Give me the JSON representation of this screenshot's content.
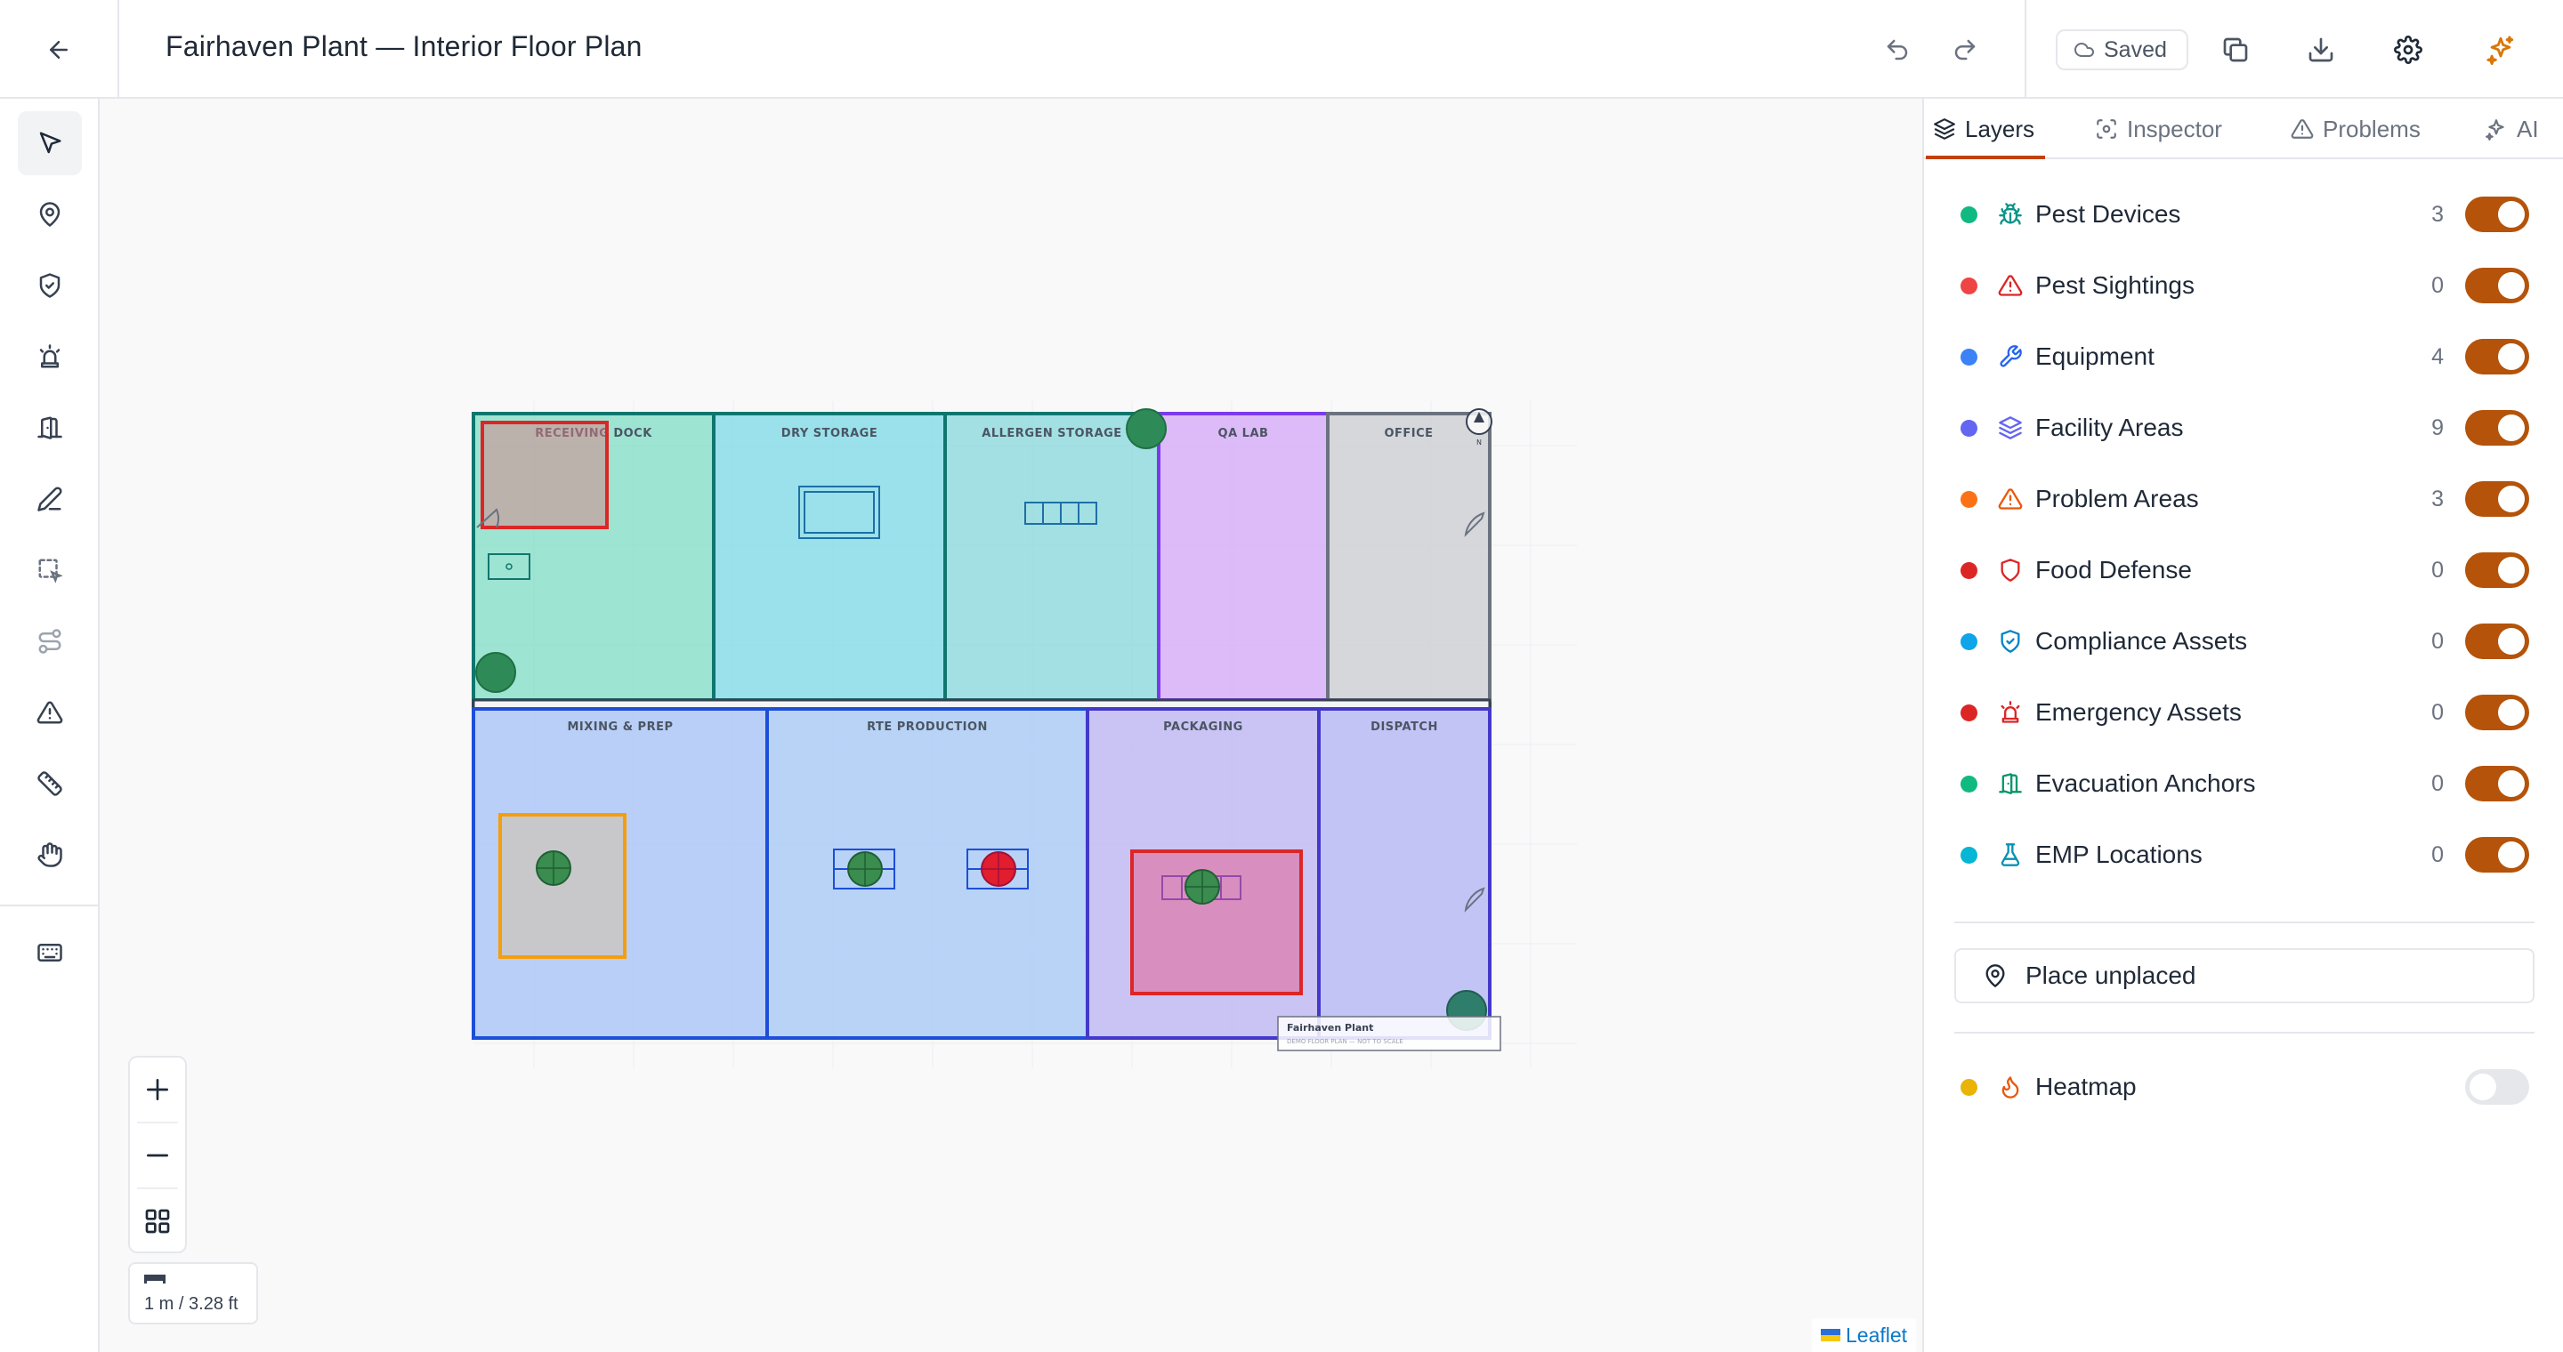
{
  "header": {
    "title": "Fairhaven Plant — Interior Floor Plan",
    "saved_label": "Saved",
    "accent": "#d97706"
  },
  "left_toolbar": {
    "tools": [
      {
        "name": "select",
        "icon": "pointer-icon"
      },
      {
        "name": "place-device",
        "icon": "map-pin-icon"
      },
      {
        "name": "food-defense",
        "icon": "shield-check-icon"
      },
      {
        "name": "emergency",
        "icon": "siren-icon"
      },
      {
        "name": "evacuation",
        "icon": "building-icon"
      },
      {
        "name": "draw",
        "icon": "pencil-icon"
      },
      {
        "name": "area-select",
        "icon": "dashed-select-icon"
      },
      {
        "name": "path",
        "icon": "route-icon"
      },
      {
        "name": "problem",
        "icon": "warning-icon"
      },
      {
        "name": "measure",
        "icon": "ruler-icon"
      },
      {
        "name": "pan",
        "icon": "hand-icon"
      },
      {
        "name": "shortcuts",
        "icon": "keyboard-icon"
      }
    ]
  },
  "map": {
    "rooms": [
      {
        "label": "RECEIVING DOCK",
        "fill": "#7fdcc4"
      },
      {
        "label": "DRY STORAGE",
        "fill": "#7ad8e6"
      },
      {
        "label": "ALLERGEN STORAGE",
        "fill": "#86d7db"
      },
      {
        "label": "QA LAB",
        "fill": "#d3a6f7"
      },
      {
        "label": "OFFICE",
        "fill": "#cfd1d6"
      },
      {
        "label": "MIXING & PREP",
        "fill": "#a9c4f7"
      },
      {
        "label": "RTE PRODUCTION",
        "fill": "#a7c9f5"
      },
      {
        "label": "PACKAGING",
        "fill": "#bdb7f2"
      },
      {
        "label": "DISPATCH",
        "fill": "#b5b7f5"
      }
    ],
    "title_block": {
      "title": "Fairhaven Plant",
      "subtitle": "DEMO FLOOR PLAN — NOT TO SCALE"
    },
    "compass_label": "N",
    "scale_label": "1 m / 3.28 ft",
    "attribution": "Leaflet"
  },
  "right_panel": {
    "tabs": [
      {
        "label": "Layers",
        "icon": "layers-icon",
        "active": true
      },
      {
        "label": "Inspector",
        "icon": "inspector-icon",
        "active": false
      },
      {
        "label": "Problems",
        "icon": "warning-icon",
        "active": false
      },
      {
        "label": "AI",
        "icon": "sparkles-icon",
        "active": false
      }
    ],
    "layers": [
      {
        "name": "Pest Devices",
        "count": "3",
        "dot": "#10b981",
        "icon": "bug-icon",
        "icon_color": "#0d9488",
        "on": true
      },
      {
        "name": "Pest Sightings",
        "count": "0",
        "dot": "#ef4444",
        "icon": "alert-triangle-icon",
        "icon_color": "#dc2626",
        "on": true
      },
      {
        "name": "Equipment",
        "count": "4",
        "dot": "#3b82f6",
        "icon": "wrench-icon",
        "icon_color": "#2563eb",
        "on": true
      },
      {
        "name": "Facility Areas",
        "count": "9",
        "dot": "#6366f1",
        "icon": "layers-icon",
        "icon_color": "#6366f1",
        "on": true
      },
      {
        "name": "Problem Areas",
        "count": "3",
        "dot": "#f97316",
        "icon": "alert-triangle-icon",
        "icon_color": "#ea580c",
        "on": true
      },
      {
        "name": "Food Defense",
        "count": "0",
        "dot": "#dc2626",
        "icon": "shield-icon",
        "icon_color": "#dc2626",
        "on": true
      },
      {
        "name": "Compliance Assets",
        "count": "0",
        "dot": "#0ea5e9",
        "icon": "shield-check-icon",
        "icon_color": "#0284c7",
        "on": true
      },
      {
        "name": "Emergency Assets",
        "count": "0",
        "dot": "#dc2626",
        "icon": "siren-icon",
        "icon_color": "#dc2626",
        "on": true
      },
      {
        "name": "Evacuation Anchors",
        "count": "0",
        "dot": "#10b981",
        "icon": "building-icon",
        "icon_color": "#059669",
        "on": true
      },
      {
        "name": "EMP Locations",
        "count": "0",
        "dot": "#06b6d4",
        "icon": "flask-icon",
        "icon_color": "#0891b2",
        "on": true
      }
    ],
    "place_unplaced_label": "Place unplaced",
    "heatmap": {
      "name": "Heatmap",
      "dot": "#eab308",
      "icon": "flame-icon",
      "icon_color": "#ea580c",
      "on": false
    }
  }
}
